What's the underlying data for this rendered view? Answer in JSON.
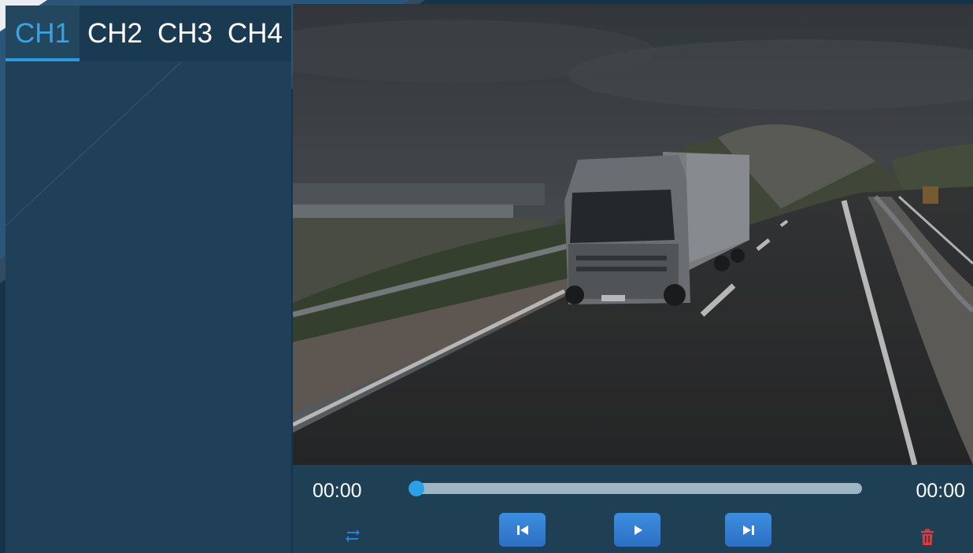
{
  "channels": {
    "tabs": [
      {
        "label": "CH1",
        "active": true
      },
      {
        "label": "CH2",
        "active": false
      },
      {
        "label": "CH3",
        "active": false
      },
      {
        "label": "CH4",
        "active": false
      }
    ]
  },
  "player": {
    "current_time": "00:00",
    "total_time": "00:00",
    "progress": 0,
    "buttons": {
      "loop_icon": "repeat-icon",
      "prev_icon": "skip-previous-icon",
      "play_icon": "play-icon",
      "next_icon": "skip-next-icon",
      "delete_icon": "trash-icon"
    }
  },
  "colors": {
    "accent": "#2a9be0",
    "panel": "#1f4058",
    "delete": "#e03a3a"
  }
}
